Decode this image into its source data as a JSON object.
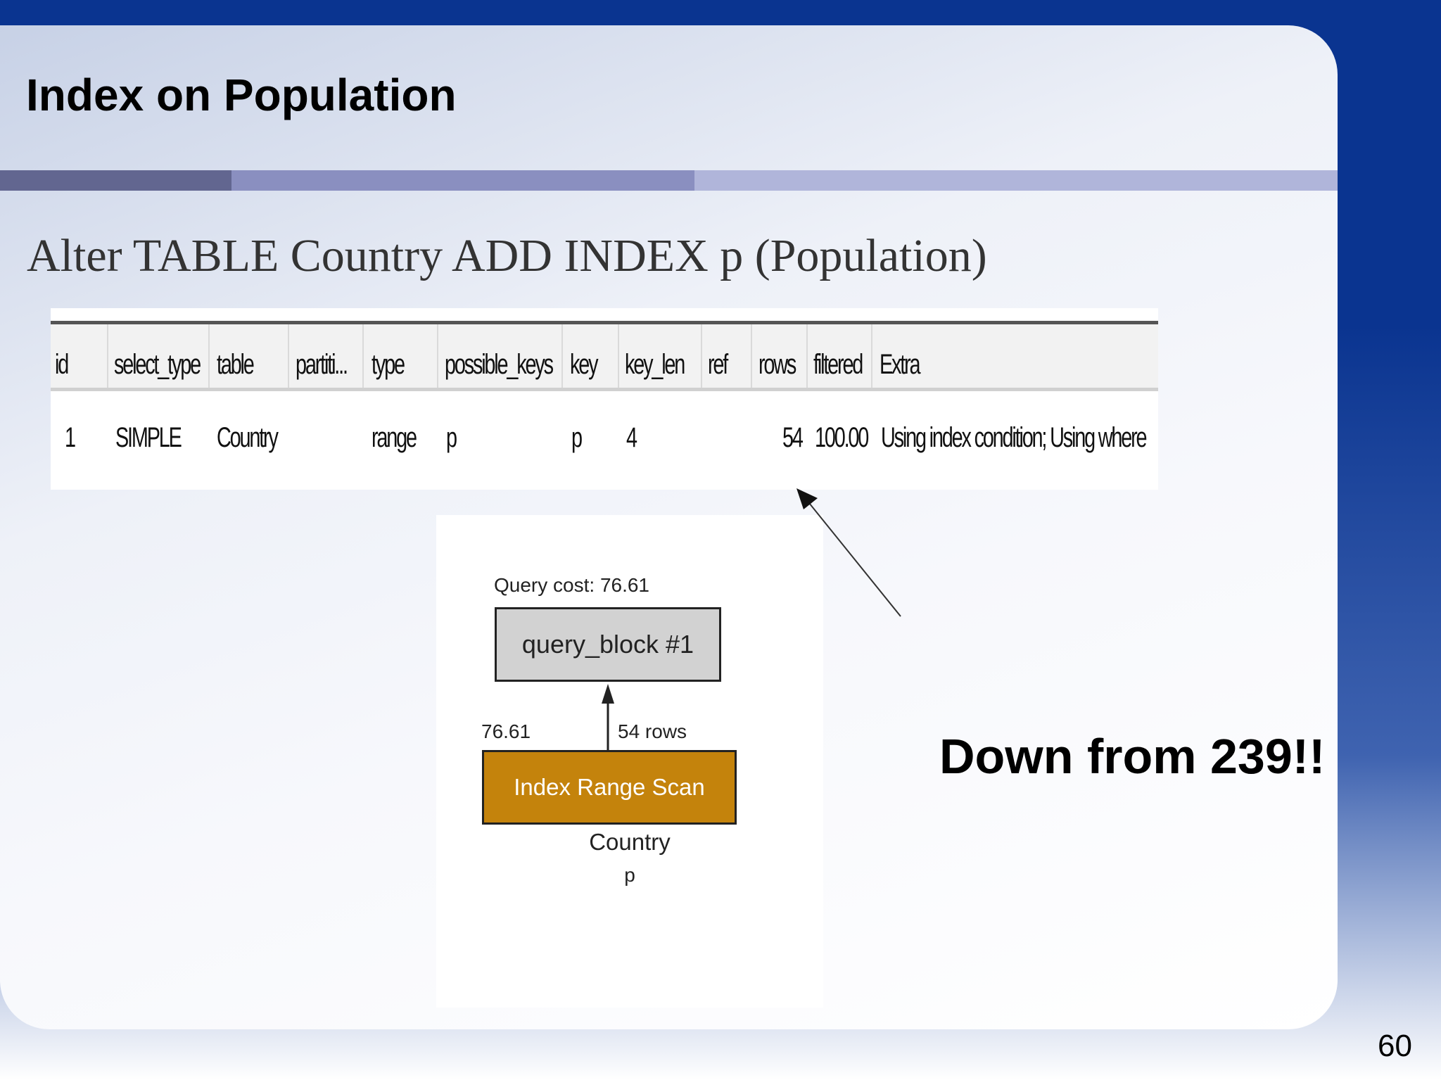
{
  "slide": {
    "title": "Index on Population",
    "subtitle": "Alter TABLE Country ADD INDEX p (Population)",
    "callout": "Down from 239!!",
    "page_number": "60"
  },
  "explain_table": {
    "headers": [
      "id",
      "select_type",
      "table",
      "partiti...",
      "type",
      "possible_keys",
      "key",
      "key_len",
      "ref",
      "rows",
      "filtered",
      "Extra"
    ],
    "row": [
      "1",
      "SIMPLE",
      "Country",
      "",
      "range",
      "p",
      "p",
      "4",
      "",
      "54",
      "100.00",
      "Using index condition; Using where"
    ]
  },
  "plan": {
    "cost_label": "Query cost: 76.61",
    "query_block": "query_block #1",
    "edge_cost": "76.61",
    "edge_rows": "54 rows",
    "scan_label": "Index Range Scan",
    "table_name": "Country",
    "key_name": "p"
  },
  "colors": {
    "background_blue": "#0a3490",
    "scan_box": "#c4830c",
    "query_block_box": "#d2d2d2"
  }
}
